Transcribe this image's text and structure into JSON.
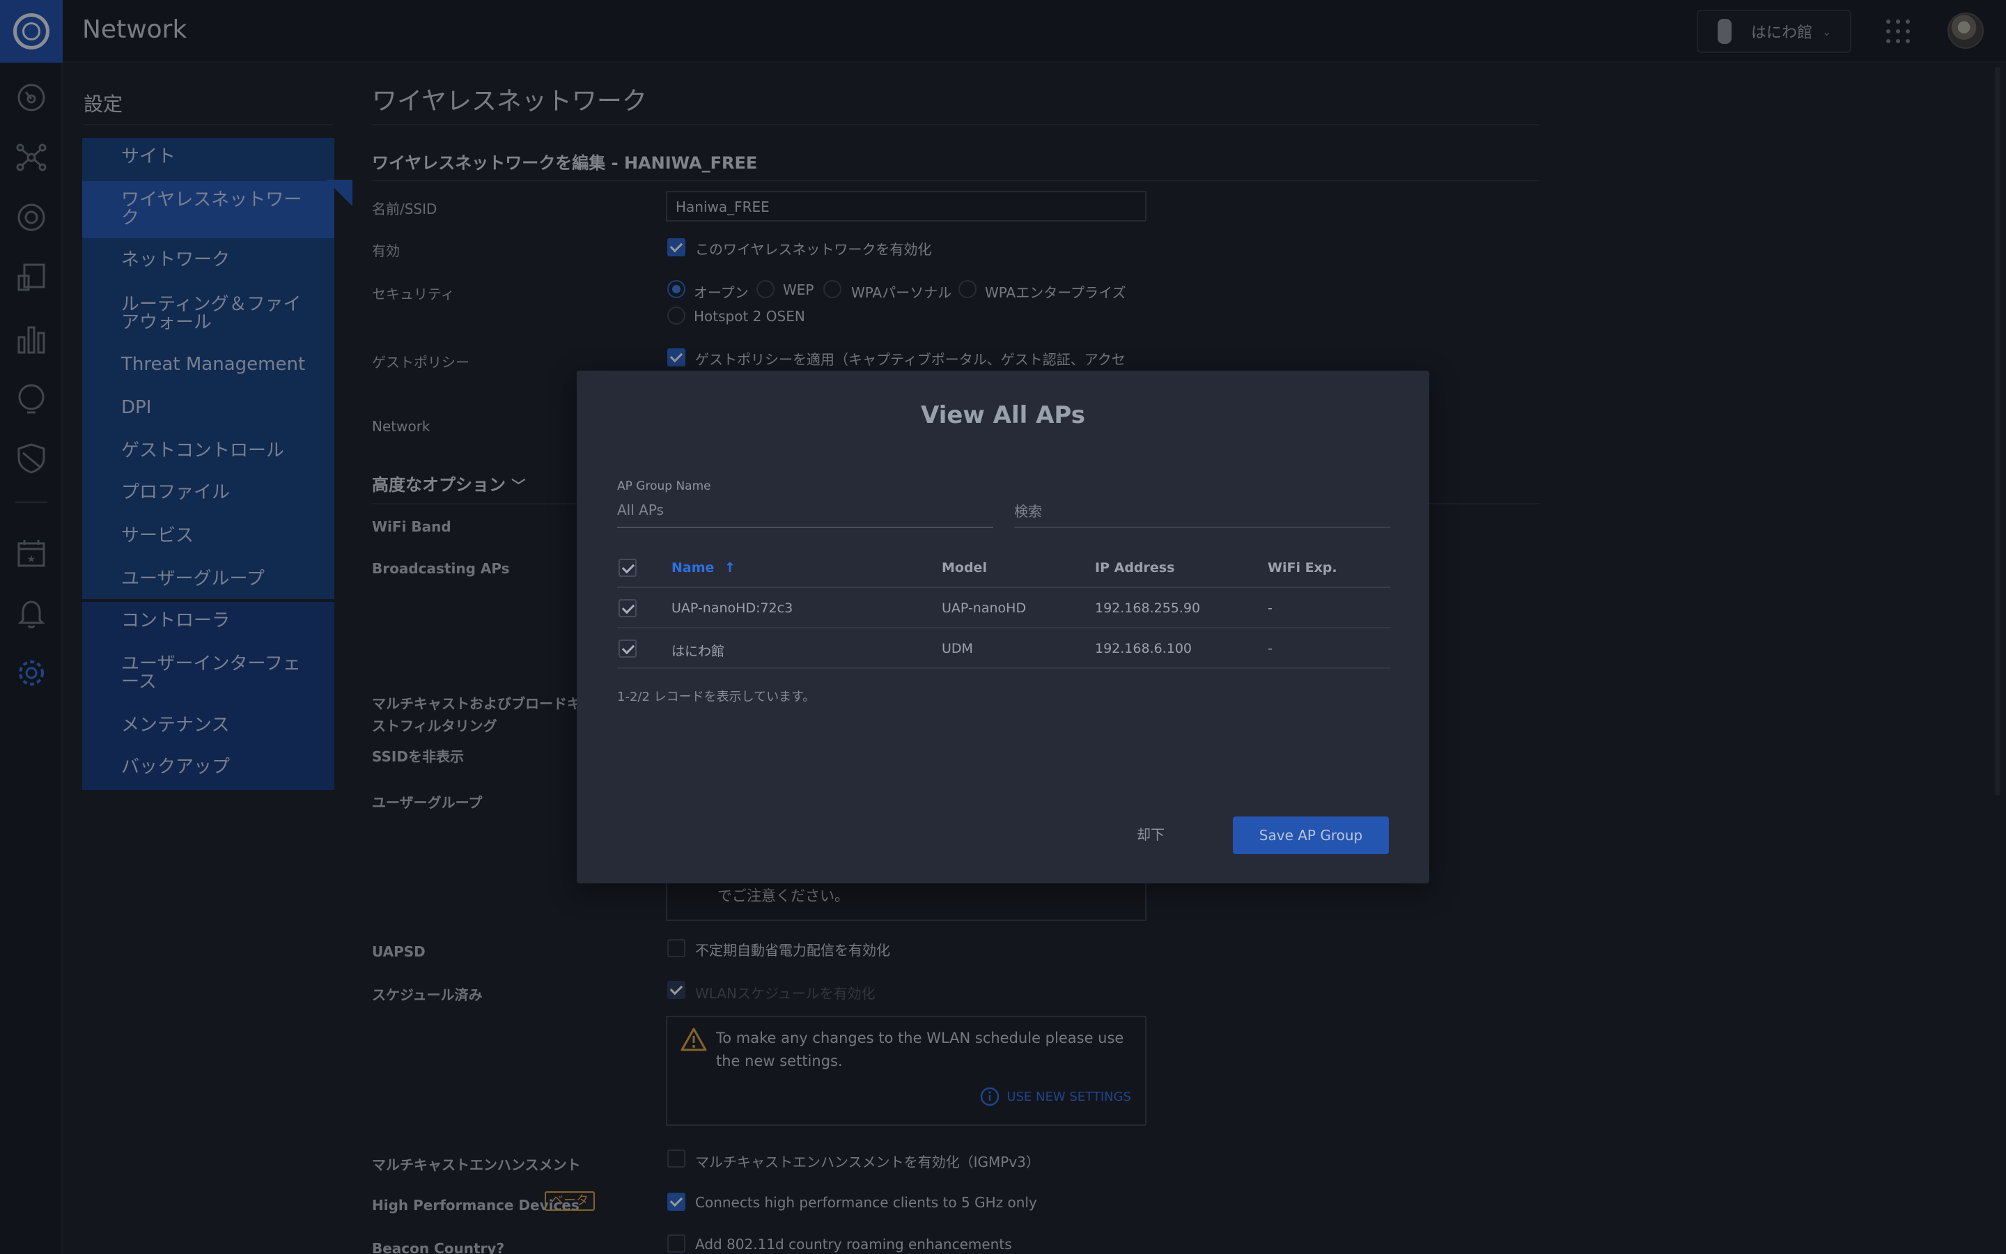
{
  "app": {
    "title": "Network",
    "site_name": "はにわ館"
  },
  "settings_nav": {
    "title": "設定",
    "group1": [
      "サイト",
      "ワイヤレスネットワーク",
      "ネットワーク",
      "ルーティング＆ファイアウォール",
      "Threat Management",
      "DPI",
      "ゲストコントロール",
      "プロファイル",
      "サービス",
      "ユーザーグループ"
    ],
    "group2": [
      "コントローラ",
      "ユーザーインターフェース",
      "メンテナンス",
      "バックアップ"
    ],
    "active": "ワイヤレスネットワーク"
  },
  "form": {
    "page_title": "ワイヤレスネットワーク",
    "edit_title": "ワイヤレスネットワークを編集 - HANIWA_FREE",
    "ssid_label": "名前/SSID",
    "ssid_value": "Haniwa_FREE",
    "enabled_label": "有効",
    "enabled_text": "このワイヤレスネットワークを有効化",
    "security_label": "セキュリティ",
    "security_options": [
      "オープン",
      "WEP",
      "WPAパーソナル",
      "WPAエンタープライズ",
      "Hotspot 2 OSEN"
    ],
    "guest_label": "ゲストポリシー",
    "guest_text": "ゲストポリシーを適用（キャプティブポータル、ゲスト認証、アクセ",
    "network_label": "Network",
    "advanced_label": "高度なオプション",
    "wifi_band_label": "WiFi Band",
    "broadcasting_label": "Broadcasting APs",
    "multicast_filter_label": "マルチキャストおよびブロードキャストフィルタリング",
    "hide_ssid_label": "SSIDを非表示",
    "user_group_label": "ユーザーグループ",
    "note_text": "でご注意ください。",
    "uapsd_label": "UAPSD",
    "uapsd_text": "不定期自動省電力配信を有効化",
    "scheduled_label": "スケジュール済み",
    "scheduled_text": "WLANスケジュールを有効化",
    "warning_text": "To make any changes to the WLAN schedule please use the new settings.",
    "use_new_settings": "USE NEW SETTINGS",
    "multicast_enh_label": "マルチキャストエンハンスメント",
    "multicast_enh_text": "マルチキャストエンハンスメントを有効化（IGMPv3）",
    "hpd_label": "High Performance Devices",
    "hpd_badge": "ベータ",
    "hpd_text": "Connects high performance clients to 5 GHz only",
    "beacon_label": "Beacon Country?",
    "beacon_text": "Add 802.11d country roaming enhancements"
  },
  "modal": {
    "title": "View All APs",
    "group_name_label": "AP Group Name",
    "group_name_value": "All APs",
    "search_placeholder": "検索",
    "columns": [
      "Name",
      "Model",
      "IP Address",
      "WiFi Exp."
    ],
    "rows": [
      {
        "name": "UAP-nanoHD:72c3",
        "model": "UAP-nanoHD",
        "ip": "192.168.255.90",
        "wifi_exp": "-"
      },
      {
        "name": "はにわ館",
        "model": "UDM",
        "ip": "192.168.6.100",
        "wifi_exp": "-"
      }
    ],
    "record_count": "1-2/2 レコードを表示しています。",
    "dismiss_label": "却下",
    "save_label": "Save AP Group"
  },
  "colors": {
    "accent": "#2a62c9",
    "nav_bg": "#17407f",
    "warning": "#e0a23c"
  }
}
